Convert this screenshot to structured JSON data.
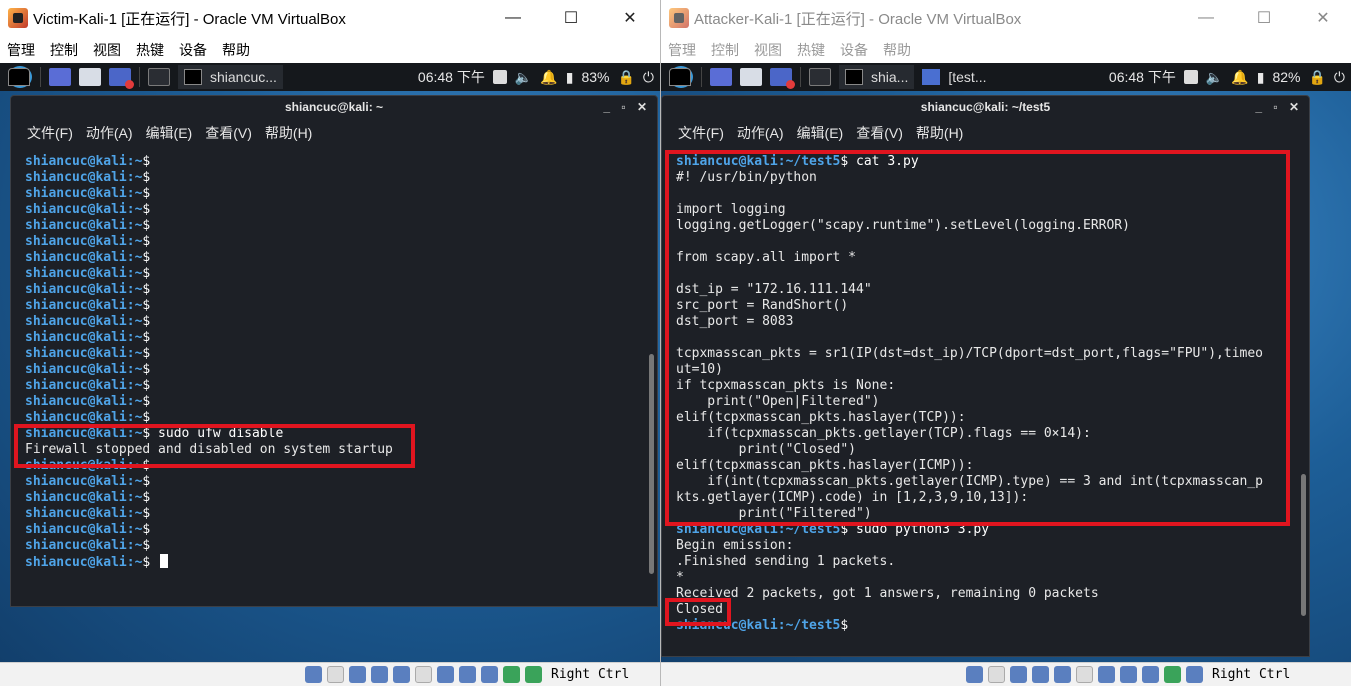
{
  "left_window": {
    "title": "Victim-Kali-1 [正在运行] - Oracle VM VirtualBox",
    "menu": [
      "管理",
      "控制",
      "视图",
      "热键",
      "设备",
      "帮助"
    ],
    "panel": {
      "task_label": "shiancuc...",
      "time": "06:48 下午",
      "battery": "83%"
    },
    "terminal": {
      "title": "shiancuc@kali: ~",
      "menu": [
        "文件(F)",
        "动作(A)",
        "编辑(E)",
        "查看(V)",
        "帮助(H)"
      ],
      "prompt_user": "shiancuc@kali",
      "prompt_dir": ":~",
      "prompt_sym": "$",
      "lines": [
        {
          "p": true,
          "cmd": ""
        },
        {
          "p": true,
          "cmd": ""
        },
        {
          "p": true,
          "cmd": ""
        },
        {
          "p": true,
          "cmd": ""
        },
        {
          "p": true,
          "cmd": ""
        },
        {
          "p": true,
          "cmd": ""
        },
        {
          "p": true,
          "cmd": ""
        },
        {
          "p": true,
          "cmd": ""
        },
        {
          "p": true,
          "cmd": ""
        },
        {
          "p": true,
          "cmd": ""
        },
        {
          "p": true,
          "cmd": ""
        },
        {
          "p": true,
          "cmd": ""
        },
        {
          "p": true,
          "cmd": ""
        },
        {
          "p": true,
          "cmd": ""
        },
        {
          "p": true,
          "cmd": ""
        },
        {
          "p": true,
          "cmd": ""
        },
        {
          "p": true,
          "cmd": ""
        },
        {
          "p": true,
          "cmd": " sudo ufw disable"
        },
        {
          "p": false,
          "text": "Firewall stopped and disabled on system startup"
        },
        {
          "p": true,
          "cmd": ""
        },
        {
          "p": true,
          "cmd": ""
        },
        {
          "p": true,
          "cmd": ""
        },
        {
          "p": true,
          "cmd": ""
        },
        {
          "p": true,
          "cmd": ""
        },
        {
          "p": true,
          "cmd": ""
        },
        {
          "p": true,
          "cmd": " ",
          "cursor": true
        }
      ]
    },
    "statusbar": {
      "hostkey": "Right Ctrl"
    }
  },
  "right_window": {
    "title": "Attacker-Kali-1 [正在运行] - Oracle VM VirtualBox",
    "menu": [
      "管理",
      "控制",
      "视图",
      "热键",
      "设备",
      "帮助"
    ],
    "panel": {
      "task_label_1": "shia...",
      "task_label_2": "[test...",
      "time": "06:48 下午",
      "battery": "82%"
    },
    "terminal": {
      "title": "shiancuc@kali: ~/test5",
      "menu": [
        "文件(F)",
        "动作(A)",
        "编辑(E)",
        "查看(V)",
        "帮助(H)"
      ],
      "prompt_user": "shiancuc@kali",
      "prompt_dir": ":~/test5",
      "prompt_sym": "$",
      "lines": [
        {
          "p": true,
          "cmd": " cat 3.py"
        },
        {
          "p": false,
          "text": "#! /usr/bin/python"
        },
        {
          "p": false,
          "text": ""
        },
        {
          "p": false,
          "text": "import logging"
        },
        {
          "p": false,
          "text": "logging.getLogger(\"scapy.runtime\").setLevel(logging.ERROR)"
        },
        {
          "p": false,
          "text": ""
        },
        {
          "p": false,
          "text": "from scapy.all import *"
        },
        {
          "p": false,
          "text": ""
        },
        {
          "p": false,
          "text": "dst_ip = \"172.16.111.144\""
        },
        {
          "p": false,
          "text": "src_port = RandShort()"
        },
        {
          "p": false,
          "text": "dst_port = 8083"
        },
        {
          "p": false,
          "text": ""
        },
        {
          "p": false,
          "text": "tcpxmasscan_pkts = sr1(IP(dst=dst_ip)/TCP(dport=dst_port,flags=\"FPU\"),timeo"
        },
        {
          "p": false,
          "text": "ut=10)"
        },
        {
          "p": false,
          "text": "if tcpxmasscan_pkts is None:"
        },
        {
          "p": false,
          "text": "    print(\"Open|Filtered\")"
        },
        {
          "p": false,
          "text": "elif(tcpxmasscan_pkts.haslayer(TCP)):"
        },
        {
          "p": false,
          "text": "    if(tcpxmasscan_pkts.getlayer(TCP).flags == 0×14):"
        },
        {
          "p": false,
          "text": "        print(\"Closed\")"
        },
        {
          "p": false,
          "text": "elif(tcpxmasscan_pkts.haslayer(ICMP)):"
        },
        {
          "p": false,
          "text": "    if(int(tcpxmasscan_pkts.getlayer(ICMP).type) == 3 and int(tcpxmasscan_p"
        },
        {
          "p": false,
          "text": "kts.getlayer(ICMP).code) in [1,2,3,9,10,13]):"
        },
        {
          "p": false,
          "text": "        print(\"Filtered\")"
        },
        {
          "p": true,
          "cmd": " sudo python3 3.py"
        },
        {
          "p": false,
          "text": "Begin emission:"
        },
        {
          "p": false,
          "text": ".Finished sending 1 packets."
        },
        {
          "p": false,
          "text": "*"
        },
        {
          "p": false,
          "text": "Received 2 packets, got 1 answers, remaining 0 packets"
        },
        {
          "p": false,
          "text": "Closed"
        },
        {
          "p": true,
          "cmd": ""
        }
      ]
    },
    "statusbar": {
      "hostkey": "Right Ctrl"
    }
  },
  "colors": {
    "highlight": "#e0151f",
    "prompt": "#4fa4e8",
    "terminal_bg": "#1d2026",
    "desktop": "#1d5e97"
  }
}
